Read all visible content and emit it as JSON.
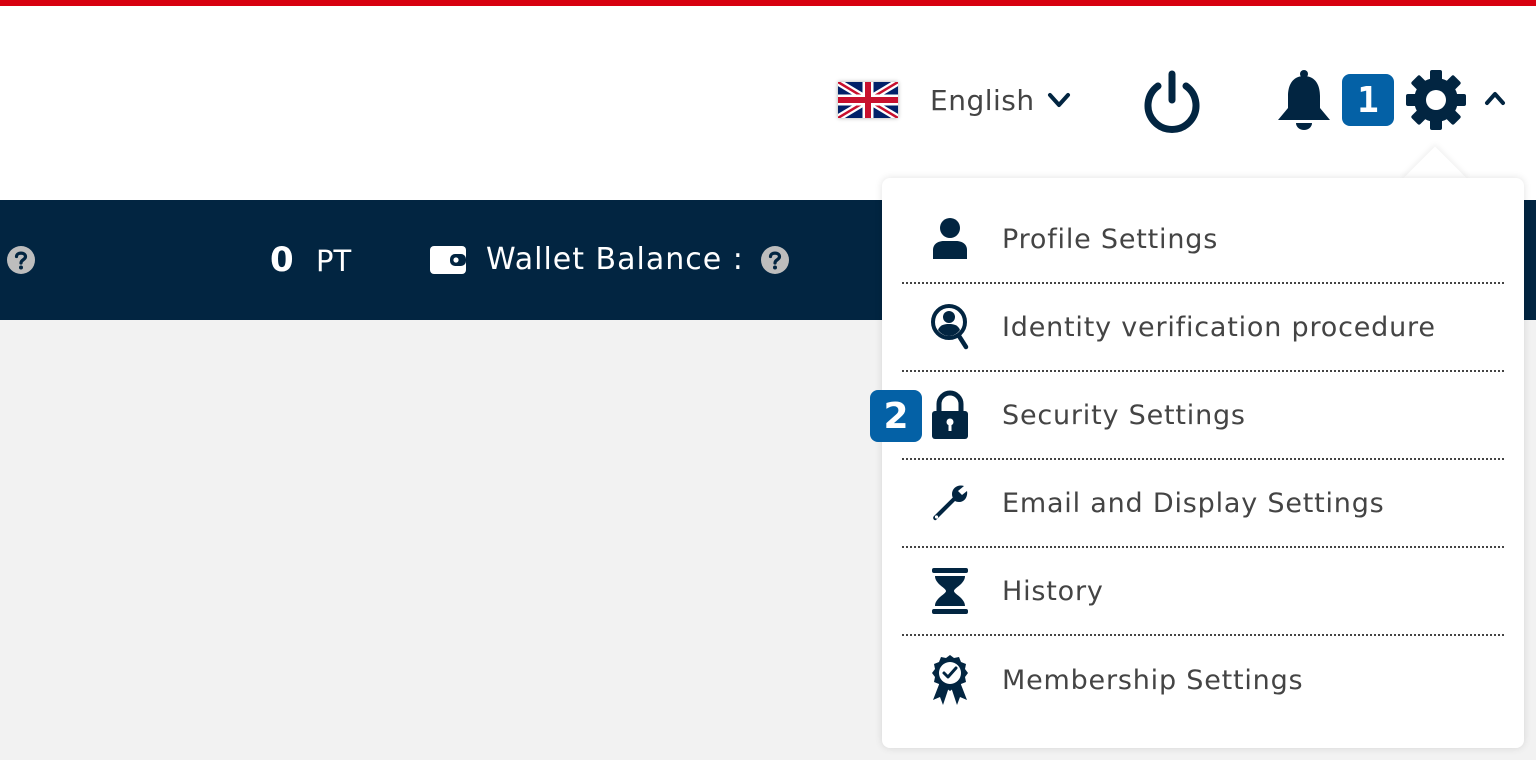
{
  "header": {
    "language": {
      "label": "English",
      "flag": "uk-flag-icon"
    },
    "power_icon": "power-icon",
    "notifications_icon": "bell-icon",
    "settings_icon": "gear-icon",
    "annotation_1": "1"
  },
  "navbar": {
    "points_value": "0",
    "points_unit": "PT",
    "wallet_label": "Wallet Balance :"
  },
  "dropdown": {
    "annotation_2": "2",
    "items": [
      {
        "label": "Profile Settings",
        "icon": "user-icon"
      },
      {
        "label": "Identity verification procedure",
        "icon": "identity-search-icon"
      },
      {
        "label": "Security Settings",
        "icon": "lock-icon"
      },
      {
        "label": "Email and Display Settings",
        "icon": "wrench-icon"
      },
      {
        "label": "History",
        "icon": "hourglass-icon"
      },
      {
        "label": "Membership Settings",
        "icon": "award-icon"
      }
    ]
  },
  "colors": {
    "accent_red": "#d7000f",
    "navy": "#022541",
    "badge_blue": "#0461a6",
    "background": "#f2f2f2"
  }
}
